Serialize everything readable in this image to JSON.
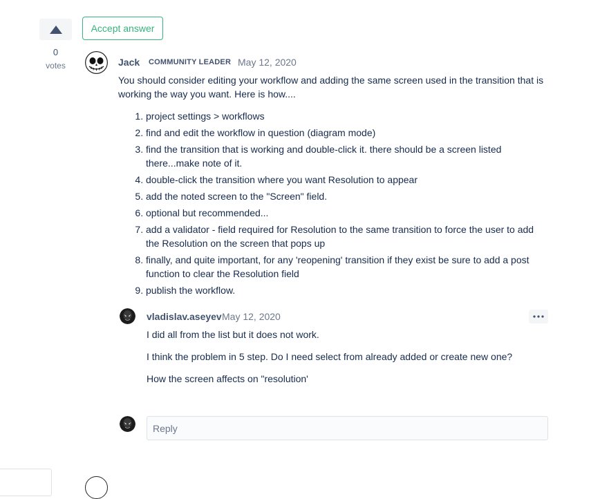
{
  "vote": {
    "count": "0",
    "label": "votes"
  },
  "accept_button": {
    "label": "Accept answer"
  },
  "answer": {
    "author": "Jack",
    "badge": "COMMUNITY LEADER",
    "date": "May 12, 2020",
    "intro": "You should consider editing your workflow and adding the same screen used in the transition that is working the way you want. Here is how....",
    "steps": [
      "project settings > workflows",
      "find and edit the workflow in question (diagram mode)",
      "find the transition that is working and double-click it. there should be a screen listed there...make note of it.",
      "double-click the transition where you want Resolution to appear",
      "add the noted screen to the \"Screen\" field.",
      "optional but recommended...",
      "add a validator - field required for Resolution to the same transition to force the user to add the Resolution on the screen that pops up",
      "finally, and quite important, for any 'reopening' transition if they exist be sure to add a post function to clear the Resolution field",
      "publish the workflow."
    ]
  },
  "comment": {
    "author": "vladislav.aseyev",
    "date": "May 12, 2020",
    "paragraphs": [
      "I did all from the list but it does not work.",
      "I think the problem in 5 step. Do I need select from already added or create new one?",
      "How the screen affects on \"resolution'"
    ]
  },
  "reply": {
    "placeholder": "Reply"
  },
  "colors": {
    "accent_green": "#36b37e",
    "text": "#172b4d",
    "muted": "#6b778c"
  },
  "icons": [
    "upvote-triangle-icon",
    "more-options-icon"
  ]
}
